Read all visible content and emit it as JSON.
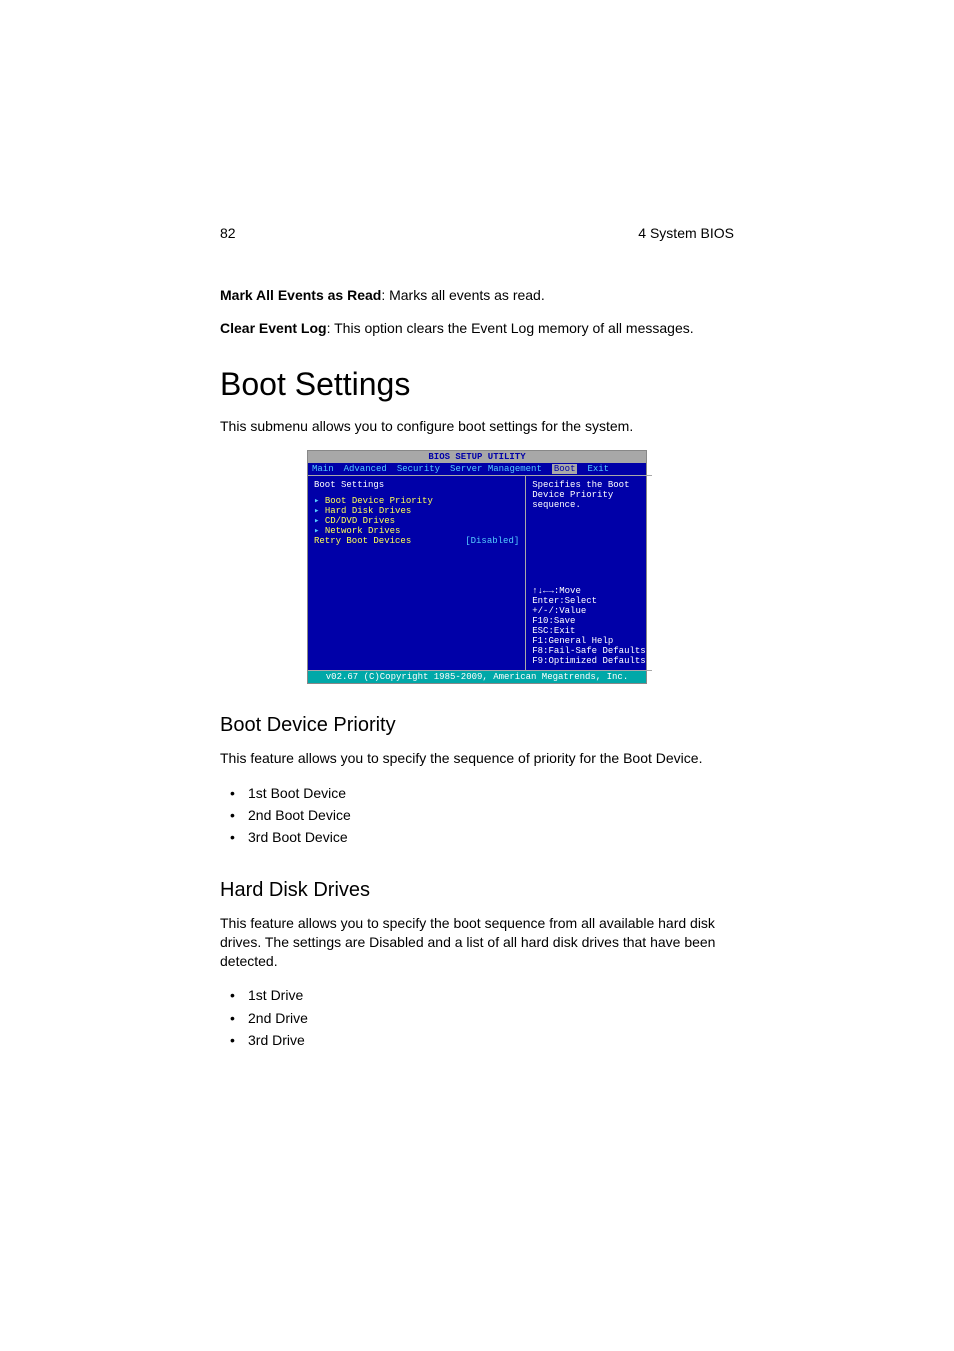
{
  "header": {
    "page_number": "82",
    "section": "4 System BIOS"
  },
  "intro": {
    "mark_events_bold": "Mark All Events as Read",
    "mark_events_rest": ": Marks all events as read.",
    "clear_log_bold": "Clear Event Log",
    "clear_log_rest": ": This option clears the Event Log memory of all messages."
  },
  "boot_settings": {
    "title": "Boot Settings",
    "intro": "This submenu allows you to configure boot settings for the system."
  },
  "bios": {
    "title": "BIOS SETUP UTILITY",
    "menu": [
      "Main",
      "Advanced",
      "Security",
      "Server Management",
      "Boot",
      "Exit"
    ],
    "selected_menu_index": 4,
    "left_heading": "Boot Settings",
    "left_items": [
      "Boot Device Priority",
      "Hard Disk Drives",
      "CD/DVD Drives",
      "Network Drives"
    ],
    "retry_label": "Retry Boot Devices",
    "retry_value": "[Disabled]",
    "help_top": "Specifies the Boot Device Priority sequence.",
    "help_keys": [
      "↑↓←→:Move",
      "Enter:Select",
      "+/-/:Value",
      "F10:Save",
      "ESC:Exit",
      "F1:General Help",
      "F8:Fail-Safe Defaults",
      "F9:Optimized Defaults"
    ],
    "footer": "v02.67 (C)Copyright 1985-2009, American Megatrends, Inc."
  },
  "boot_device_priority": {
    "title": "Boot Device Priority",
    "intro": "This feature allows you to specify the sequence of priority for the Boot Device.",
    "items": [
      "1st Boot Device",
      "2nd Boot Device",
      "3rd Boot Device"
    ]
  },
  "hard_disk_drives": {
    "title": "Hard Disk Drives",
    "intro": "This feature allows you to specify the boot sequence from all available hard disk drives. The settings are Disabled and a list of all hard disk drives that have been detected.",
    "items": [
      "1st Drive",
      "2nd Drive",
      "3rd Drive"
    ]
  }
}
